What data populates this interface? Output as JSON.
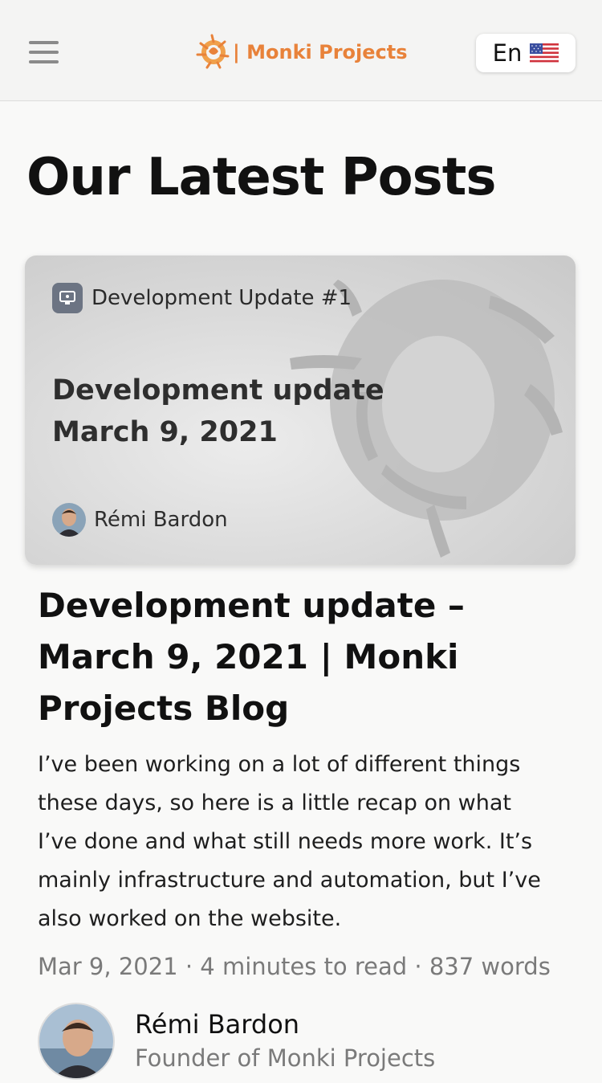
{
  "header": {
    "brand_name": "| Monki Projects",
    "language_label": "En",
    "language_flag_icon": "us-flag-icon",
    "menu_icon": "hamburger-menu-icon",
    "brand_color": "#e8823a"
  },
  "page": {
    "title": "Our Latest Posts"
  },
  "post": {
    "series_label": "Development Update #1",
    "series_icon": "monitor-icon",
    "card_heading_lines": [
      "Development update",
      "March 9, 2021"
    ],
    "card_author": "Rémi Bardon",
    "title_lines": [
      "Development update –",
      "March 9, 2021 | Monki",
      "Projects Blog"
    ],
    "excerpt_lines": [
      "I’ve been working on a lot of different things",
      "these days, so here is a little recap on what",
      "I’ve done and what still needs more work. It’s",
      "mainly infrastructure and automation, but I’ve",
      "also worked on the website."
    ],
    "meta": "Mar 9, 2021 · 4 minutes to read · 837 words"
  },
  "author": {
    "name": "Rémi Bardon",
    "role": "Founder of Monki Projects"
  }
}
